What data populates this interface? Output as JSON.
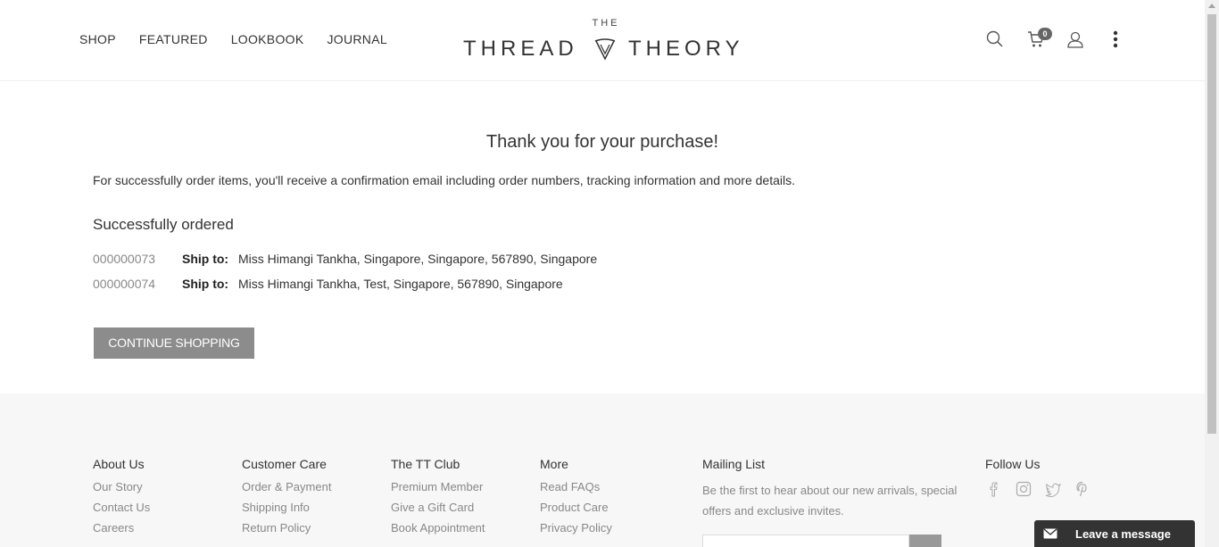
{
  "header": {
    "nav": [
      "SHOP",
      "FEATURED",
      "LOOKBOOK",
      "JOURNAL"
    ],
    "logo": {
      "top": "THE",
      "left_word": "THREAD",
      "right_word": "THEORY"
    },
    "cart_count": "0",
    "icons": [
      "search-icon",
      "cart-icon",
      "user-icon",
      "more-vertical-icon"
    ]
  },
  "main": {
    "title": "Thank you for your purchase!",
    "info": "For successfully order items, you'll receive a confirmation email including order numbers, tracking information and more details.",
    "ordered_heading": "Successfully ordered",
    "orders": [
      {
        "number": "000000073",
        "ship_label": "Ship to:",
        "address": "Miss Himangi Tankha, Singapore, Singapore, 567890, Singapore"
      },
      {
        "number": "000000074",
        "ship_label": "Ship to:",
        "address": "Miss Himangi Tankha, Test, Singapore, 567890, Singapore"
      }
    ],
    "continue_label": "CONTINUE SHOPPING"
  },
  "footer": {
    "about": {
      "title": "About Us",
      "links": [
        "Our Story",
        "Contact Us",
        "Careers"
      ]
    },
    "care": {
      "title": "Customer Care",
      "links": [
        "Order & Payment",
        "Shipping Info",
        "Return Policy"
      ]
    },
    "club": {
      "title": "The TT Club",
      "links": [
        "Premium Member",
        "Give a Gift Card",
        "Book Appointment"
      ]
    },
    "more": {
      "title": "More",
      "links": [
        "Read FAQs",
        "Product Care",
        "Privacy Policy"
      ]
    },
    "mailing": {
      "title": "Mailing List",
      "text": "Be the first to hear about our new arrivals, special offers and exclusive invites."
    },
    "follow": {
      "title": "Follow Us",
      "icons": [
        "facebook-icon",
        "instagram-icon",
        "twitter-icon",
        "pinterest-icon"
      ]
    }
  },
  "chat": {
    "label": "Leave a message"
  },
  "colors": {
    "button": "#8c8c8c",
    "footer_bg": "#f7f7f7",
    "chat_bg": "#333333"
  }
}
